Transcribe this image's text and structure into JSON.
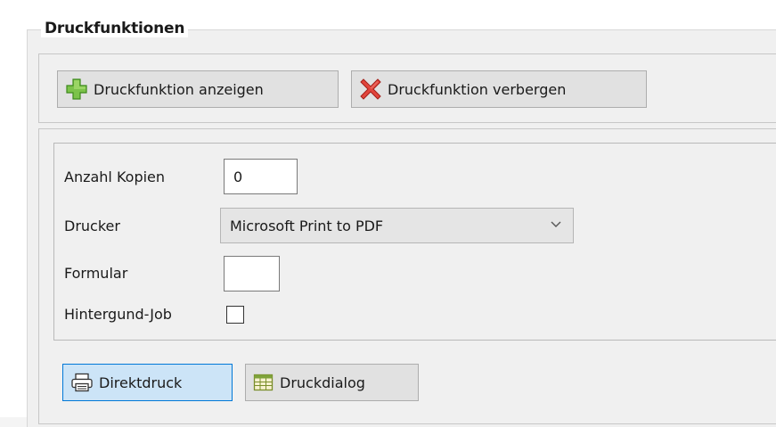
{
  "group": {
    "title": "Druckfunktionen"
  },
  "toolbar": {
    "show_label": "Druckfunktion anzeigen",
    "hide_label": "Druckfunktion verbergen"
  },
  "form": {
    "copies_label": "Anzahl Kopien",
    "copies_value": "0",
    "printer_label": "Drucker",
    "printer_value": "Microsoft Print to PDF",
    "form_label": "Formular",
    "form_value": "",
    "background_label": "Hintergund-Job",
    "background_checked": false
  },
  "actions": {
    "direct_label": "Direktdruck",
    "dialog_label": "Druckdialog"
  },
  "colors": {
    "accent_button_bg": "#cce4f7",
    "accent_button_border": "#0078d7"
  }
}
